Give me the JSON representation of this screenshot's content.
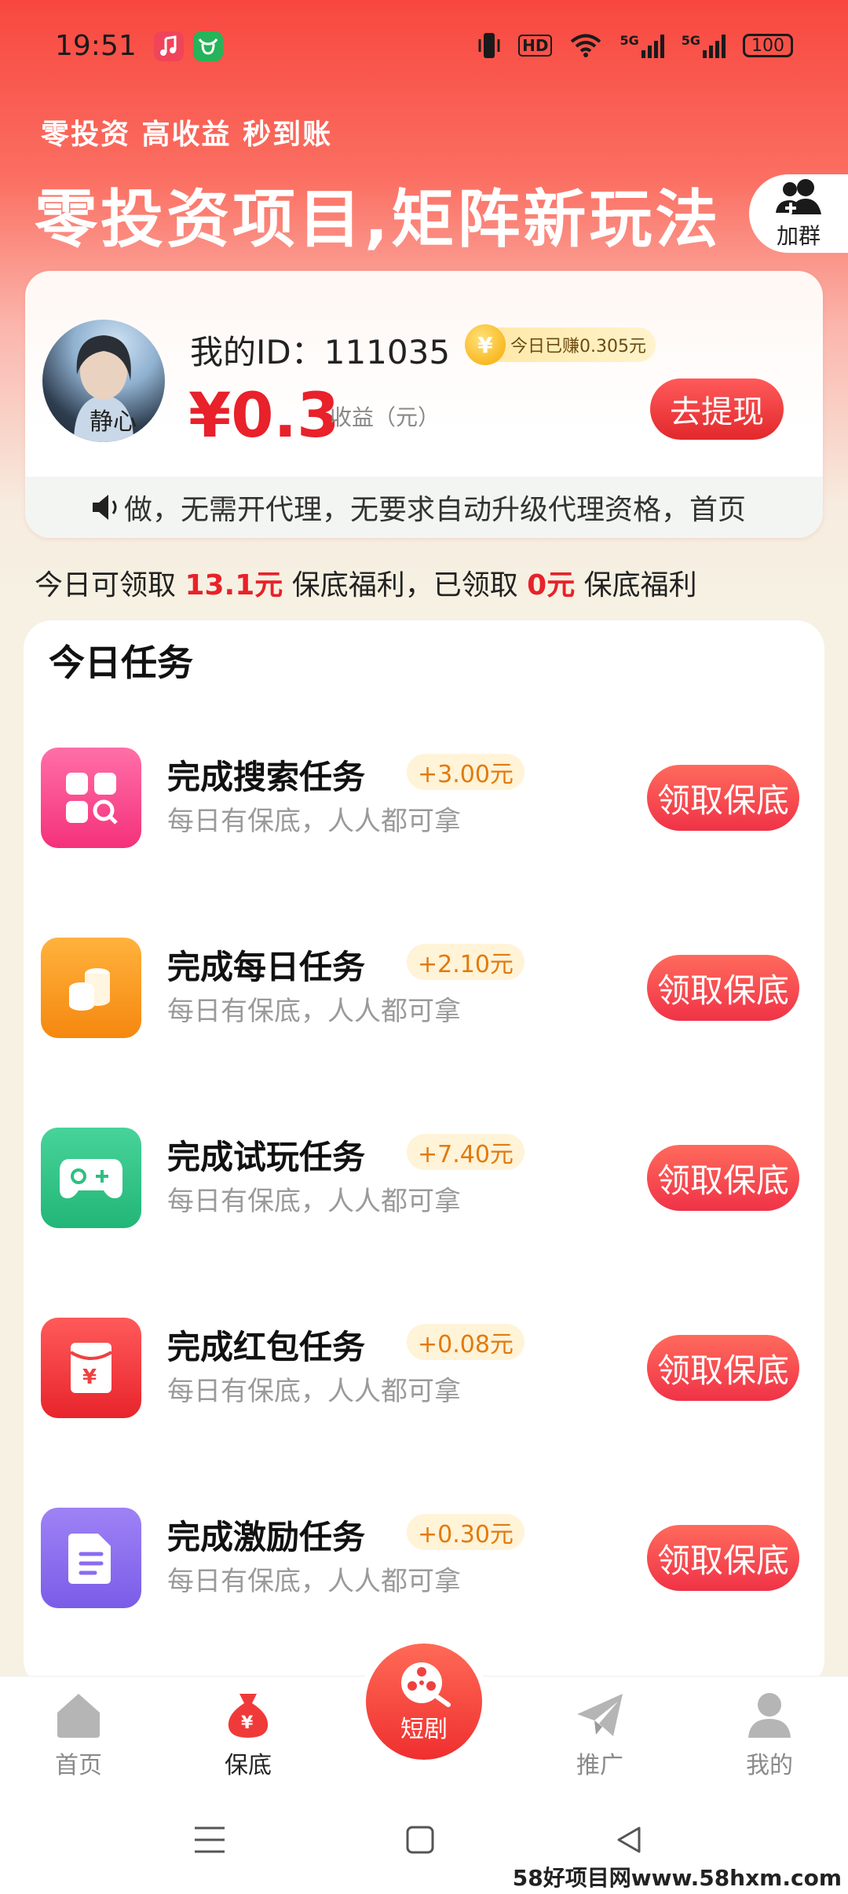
{
  "status_bar": {
    "time": "19:51",
    "hd_label": "HD",
    "net1": "5G",
    "net2": "5G",
    "battery": "100"
  },
  "banner": {
    "tagline": "零投资 高收益 秒到账",
    "headline": "零投资项目,矩阵新玩法",
    "join_group_label": "加群"
  },
  "profile": {
    "user_id_label": "我的ID：",
    "user_id": "111035",
    "today_earned_badge": "今日已赚0.305元",
    "coin_symbol": "¥",
    "balance": "¥0.3",
    "balance_label": "收益（元）",
    "withdraw_label": "去提现",
    "marquee_text": "做，无需开代理，无要求自动升级代理资格，首页"
  },
  "welfare": {
    "prefix": "今日可领取 ",
    "available_amount": "13.1元",
    "middle": " 保底福利，已领取 ",
    "claimed_amount": "0元",
    "suffix": " 保底福利"
  },
  "tasks": {
    "section_title": "今日任务",
    "items": [
      {
        "name": "完成搜索任务",
        "reward": "+3.00元",
        "desc": "每日有保底，人人都可拿",
        "button": "领取保底",
        "icon": "grid-search-icon",
        "color_from": "#ff6fa8",
        "color_to": "#f4317a"
      },
      {
        "name": "完成每日任务",
        "reward": "+2.10元",
        "desc": "每日有保底，人人都可拿",
        "button": "领取保底",
        "icon": "coins-icon",
        "color_from": "#ffb23d",
        "color_to": "#f5880f"
      },
      {
        "name": "完成试玩任务",
        "reward": "+7.40元",
        "desc": "每日有保底，人人都可拿",
        "button": "领取保底",
        "icon": "gamepad-icon",
        "color_from": "#47d39a",
        "color_to": "#22b677"
      },
      {
        "name": "完成红包任务",
        "reward": "+0.08元",
        "desc": "每日有保底，人人都可拿",
        "button": "领取保底",
        "icon": "red-envelope-icon",
        "color_from": "#ff5a5a",
        "color_to": "#e8242c"
      },
      {
        "name": "完成激励任务",
        "reward": "+0.30元",
        "desc": "每日有保底，人人都可拿",
        "button": "领取保底",
        "icon": "document-icon",
        "color_from": "#9e82f5",
        "color_to": "#7a5de8"
      }
    ]
  },
  "bottom_nav": {
    "home": "首页",
    "guarantee": "保底",
    "short_drama": "短剧",
    "promote": "推广",
    "mine": "我的",
    "active": "guarantee"
  },
  "watermark": "58好项目网www.58hxm.com",
  "colors": {
    "accent_red": "#e8212a",
    "reward_orange": "#e27a0c"
  }
}
